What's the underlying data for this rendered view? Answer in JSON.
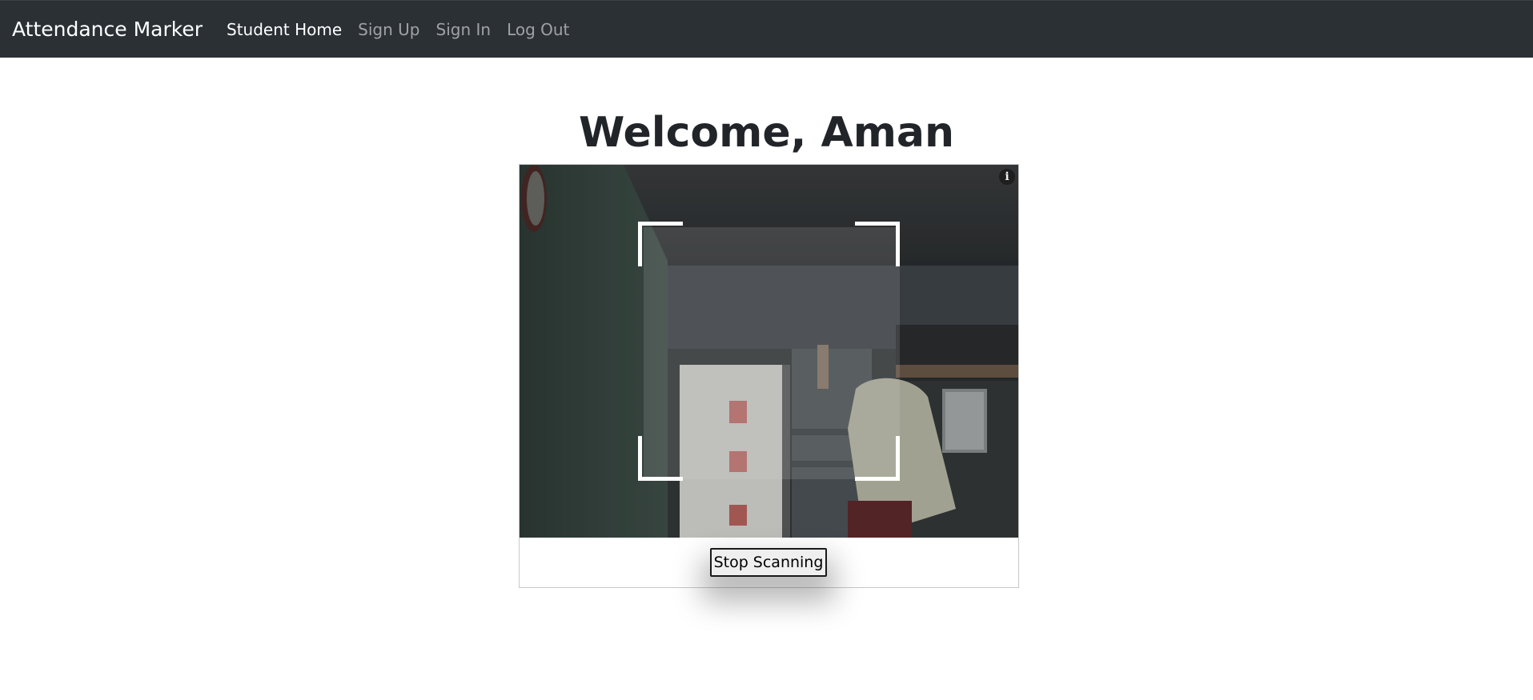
{
  "navbar": {
    "brand": "Attendance Marker",
    "links": [
      {
        "label": "Student Home",
        "active": true
      },
      {
        "label": "Sign Up",
        "active": false
      },
      {
        "label": "Sign In",
        "active": false
      },
      {
        "label": "Log Out",
        "active": false
      }
    ]
  },
  "page": {
    "title": "Welcome, Aman"
  },
  "scanner": {
    "info_icon": "info-icon",
    "info_glyph": "i",
    "stop_button_label": "Stop Scanning"
  },
  "colors": {
    "navbar_bg": "#2b3035",
    "nav_active": "#ffffff",
    "nav_inactive": "#8c8f92",
    "title": "#212529"
  }
}
